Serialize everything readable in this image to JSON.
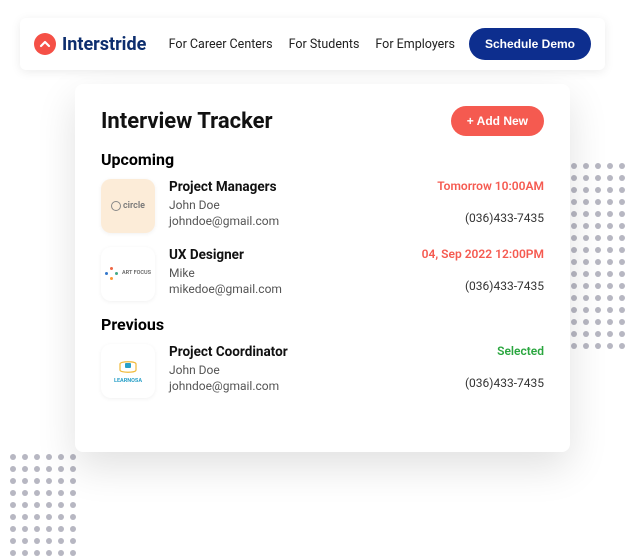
{
  "brand": {
    "name": "Interstride"
  },
  "nav": {
    "careerCenters": "For Career Centers",
    "students": "For Students",
    "employers": "For Employers",
    "demoBtn": "Schedule Demo"
  },
  "tracker": {
    "title": "Interview Tracker",
    "addBtn": "+ Add New",
    "sections": {
      "upcoming": {
        "title": "Upcoming",
        "items": [
          {
            "company": "circle",
            "role": "Project Managers",
            "contact": "John Doe",
            "email": "johndoe@gmail.com",
            "time": "Tomorrow 10:00AM",
            "phone": "(036)433-7435"
          },
          {
            "company": "ART FOCUS",
            "role": "UX Designer",
            "contact": "Mike",
            "email": "mikedoe@gmail.com",
            "time": "04, Sep 2022 12:00PM",
            "phone": "(036)433-7435"
          }
        ]
      },
      "previous": {
        "title": "Previous",
        "items": [
          {
            "company": "LEARNOSA",
            "role": "Project Coordinator",
            "contact": "John Doe",
            "email": "johndoe@gmail.com",
            "status": "Selected",
            "phone": "(036)433-7435"
          }
        ]
      }
    }
  }
}
